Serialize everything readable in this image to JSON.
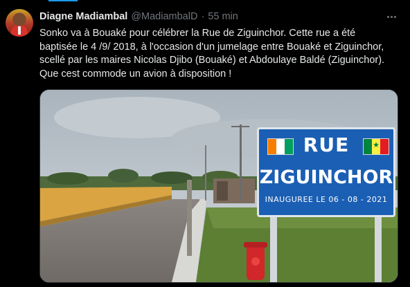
{
  "tweet": {
    "display_name": "Diagne Madiambal",
    "handle": "@MadiambalD",
    "separator": "·",
    "time": "55 min",
    "text_lines": [
      "Sonko va à Bouaké pour célébrer la Rue de Ziguinchor.  Cette rue a été",
      "baptisée le 4 /9/ 2018, à l'occasion d'un jumelage entre Bouaké et Ziguinchor,",
      "scellé par les maires Nicolas Djibo (Bouaké) et Abdoulaye Baldé (Ziguinchor).",
      "Que cest commode un avion à disposition !"
    ]
  },
  "media": {
    "sign": {
      "line1": "RUE",
      "line2": "ZIGUINCHOR",
      "line3": "INAUGUREE LE 06 - 08 - 2021"
    }
  },
  "icons": {
    "more": "more-dots-icon",
    "avatar": "avatar"
  },
  "colors": {
    "background": "#000000",
    "text": "#e7e9ea",
    "secondary_text": "#71767b",
    "accent": "#1d9bf0",
    "sign_blue": "#1b5fb4"
  }
}
